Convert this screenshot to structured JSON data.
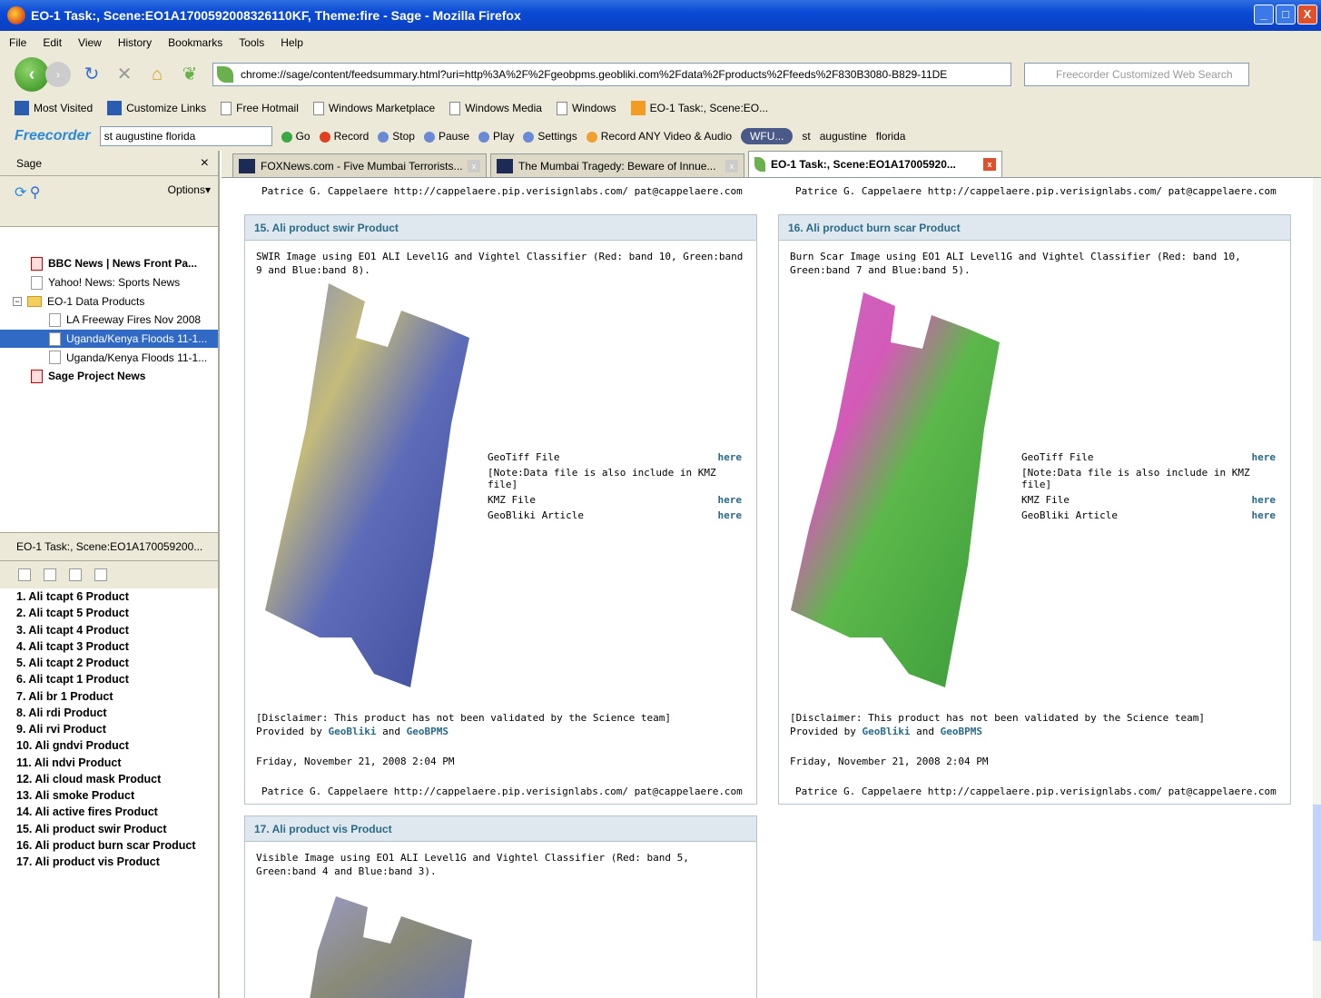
{
  "window": {
    "title": "EO-1 Task:, Scene:EO1A1700592008326110KF, Theme:fire - Sage - Mozilla Firefox",
    "controls": [
      "_",
      "□",
      "X"
    ]
  },
  "menu": [
    "File",
    "Edit",
    "View",
    "History",
    "Bookmarks",
    "Tools",
    "Help"
  ],
  "nav": {
    "url": "chrome://sage/content/feedsummary.html?uri=http%3A%2F%2Fgeobpms.geobliki.com%2Fdata%2Fproducts%2Ffeeds%2F830B3080-B829-11DE",
    "search_placeholder": "Freecorder Customized Web Search"
  },
  "bookmarks": [
    "Most Visited",
    "Customize Links",
    "Free Hotmail",
    "Windows Marketplace",
    "Windows Media",
    "Windows",
    "EO-1 Task:, Scene:EO..."
  ],
  "freecorder": {
    "logo": "Freecorder",
    "search_value": "st augustine florida",
    "go": "Go",
    "record": "Record",
    "stop": "Stop",
    "pause": "Pause",
    "play": "Play",
    "settings": "Settings",
    "record_any": "Record ANY Video & Audio",
    "station": "WFU...",
    "b1": "st",
    "b2": "augustine",
    "b3": "florida"
  },
  "sidebar": {
    "title": "Sage",
    "close": "×",
    "options": "Options▾",
    "tree": [
      {
        "label": "BBC News | News Front Pa...",
        "bold": true,
        "indent": 1,
        "icon": "feed-red"
      },
      {
        "label": "Yahoo! News: Sports News",
        "indent": 1,
        "icon": "page"
      },
      {
        "label": "EO-1 Data Products",
        "indent": 0,
        "icon": "folder"
      },
      {
        "label": "LA Freeway Fires Nov 2008",
        "indent": 2,
        "icon": "page"
      },
      {
        "label": "Uganda/Kenya Floods 11-1...",
        "indent": 2,
        "icon": "page",
        "selected": true
      },
      {
        "label": "Uganda/Kenya Floods 11-1...",
        "indent": 2,
        "icon": "page"
      },
      {
        "label": "Sage Project News",
        "bold": true,
        "indent": 1,
        "icon": "feed-red"
      }
    ],
    "feed_title": "EO-1 Task:, Scene:EO1A170059200...",
    "items": [
      "1. Ali tcapt 6 Product",
      "2. Ali tcapt 5 Product",
      "3. Ali tcapt 4 Product",
      "4. Ali tcapt 3 Product",
      "5. Ali tcapt 2 Product",
      "6. Ali tcapt 1 Product",
      "7. Ali br 1 Product",
      "8. Ali rdi Product",
      "9. Ali rvi Product",
      "10. Ali gndvi Product",
      "11. Ali ndvi Product",
      "12. Ali cloud mask Product",
      "13. Ali smoke Product",
      "14. Ali active fires Product",
      "15. Ali product swir Product",
      "16. Ali product burn scar Product",
      "17. Ali product vis Product"
    ]
  },
  "tabs": [
    {
      "label": "FOXNews.com - Five Mumbai Terrorists..."
    },
    {
      "label": "The Mumbai Tragedy: Beware of Innue..."
    },
    {
      "label": "EO-1 Task:, Scene:EO1A17005920...",
      "active": true
    }
  ],
  "content": {
    "author_line": "Patrice G. Cappelaere http://cappelaere.pip.verisignlabs.com/ pat@cappelaere.com",
    "geotiff": "GeoTiff File",
    "note": "[Note:Data file is also include in KMZ file]",
    "kmz": "KMZ File",
    "article": "GeoBliki Article",
    "here": "here",
    "disclaimer": "[Disclaimer: This product has not been validated by the Science team]",
    "provided_by": "Provided by",
    "geobliki": "GeoBliki",
    "and": "and",
    "geobpms": "GeoBPMS",
    "date": "Friday, November 21, 2008 2:04 PM",
    "cards": [
      {
        "title": "15.  Ali product swir Product",
        "desc": "SWIR Image using EO1 ALI Level1G and Vightel Classifier (Red: band 10, Green:band 9 and Blue:band 8)."
      },
      {
        "title": "16.  Ali product burn scar Product",
        "desc": "Burn Scar Image using EO1 ALI Level1G and Vightel Classifier (Red: band 10, Green:band 7 and Blue:band 5)."
      },
      {
        "title": "17.  Ali product vis Product",
        "desc": "Visible Image using EO1 ALI Level1G and Vightel Classifier (Red: band 5, Green:band 4 and Blue:band 3)."
      }
    ]
  }
}
